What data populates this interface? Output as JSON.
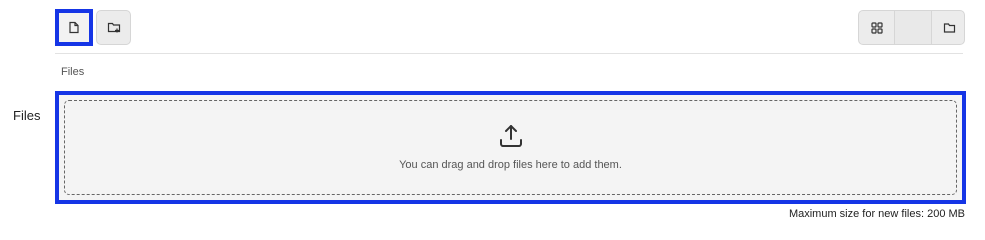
{
  "toolbar": {
    "add_file_icon": "file-icon",
    "add_folder_icon": "folder-plus-icon",
    "view_grid_icon": "grid-icon",
    "view_folder_icon": "folder-icon",
    "highlight_color": "#1535e6"
  },
  "breadcrumb": {
    "label": "Files"
  },
  "field": {
    "label": "Files"
  },
  "dropzone": {
    "icon": "upload-icon",
    "text": "You can drag and drop files here to add them."
  },
  "footer": {
    "max_size_text": "Maximum size for new files: 200 MB"
  }
}
